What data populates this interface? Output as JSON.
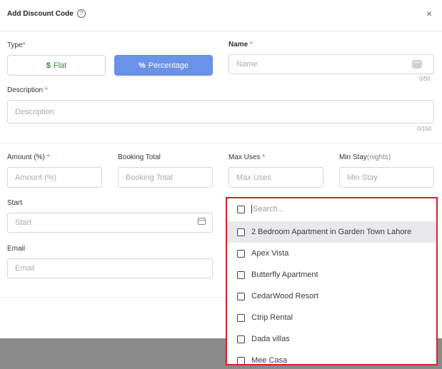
{
  "modal": {
    "title": "Add Discount Code",
    "help_icon": "question-circle-icon",
    "close_icon": "close-icon"
  },
  "type": {
    "label": "Type",
    "required": "*",
    "flat_symbol": "$",
    "flat_label": "Flat",
    "percentage_symbol": "%",
    "percentage_label": "Percentage",
    "selected": "Percentage",
    "accent": "#6a93e8",
    "flat_color": "#2e8b3c"
  },
  "name": {
    "label": "Name",
    "required": "*",
    "placeholder": "Name",
    "counter": "0/50"
  },
  "description": {
    "label": "Description",
    "required": "*",
    "placeholder": "Description",
    "counter": "0/150"
  },
  "amount": {
    "label": "Amount (%)",
    "required": "*",
    "placeholder": "Amount (%)"
  },
  "booking_total": {
    "label": "Booking Total",
    "placeholder": "Booking Total"
  },
  "max_uses": {
    "label": "Max Uses",
    "required": "*",
    "placeholder": "Max Uses"
  },
  "min_stay": {
    "label": "Min Stay",
    "unit": "(nights)",
    "placeholder": "Min Stay"
  },
  "start": {
    "label": "Start",
    "placeholder": "Start",
    "icon": "calendar-icon"
  },
  "email": {
    "label": "Email",
    "placeholder": "Email"
  },
  "dropdown": {
    "search_placeholder": "Search...",
    "items": [
      "2 Bedroom Apartment in Garden Town Lahore",
      "Apex Vista",
      "Butterfly Apartment",
      "CedarWood Resort",
      "Ctrip Rental",
      "Dada villas",
      "Mee Casa"
    ],
    "highlight_color": "#d9202a"
  }
}
